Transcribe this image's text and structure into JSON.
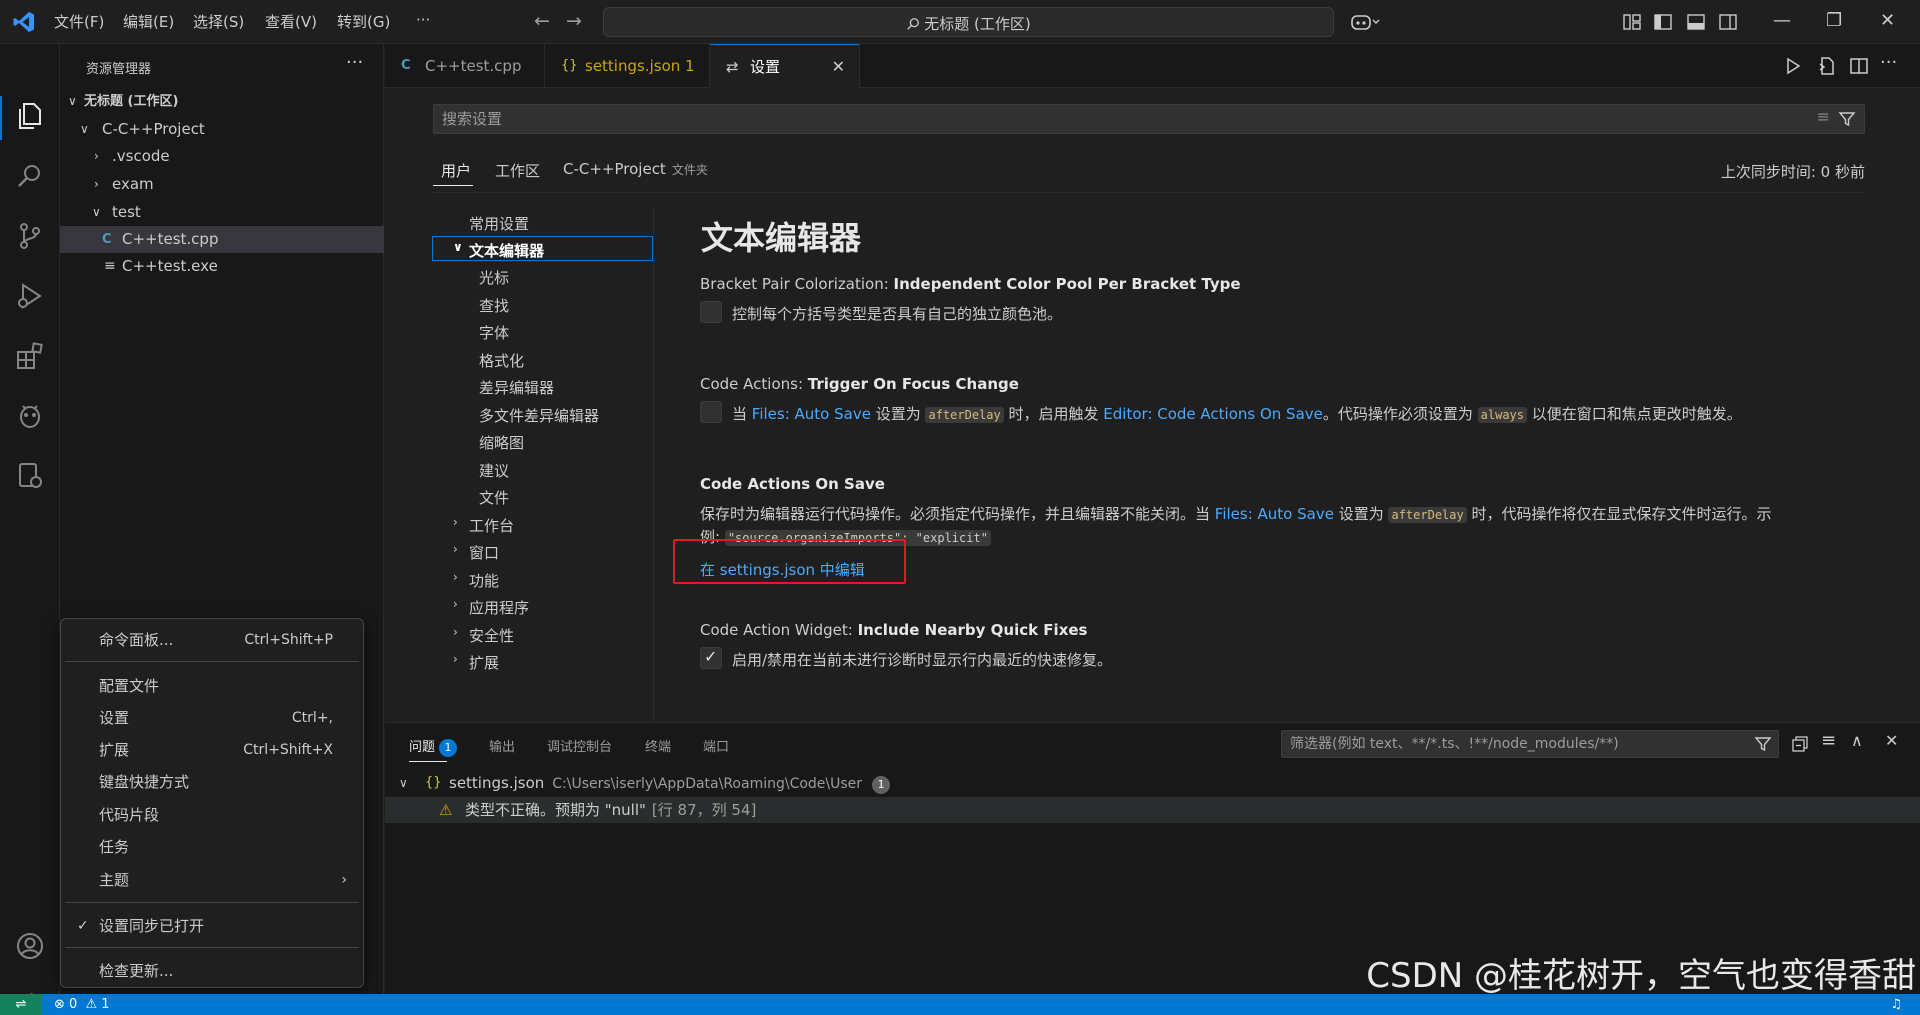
{
  "titlebar": {
    "menus": [
      "文件(F)",
      "编辑(E)",
      "选择(S)",
      "查看(V)",
      "转到(G)"
    ],
    "more": "···",
    "command_center": "无标题 (工作区)",
    "win_min": "—",
    "win_restore": "❐",
    "win_close": "✕"
  },
  "sidebar": {
    "title": "资源管理器",
    "more": "···",
    "workspace": "无标题 (工作区)",
    "folders": {
      "project": "C-C++Project",
      "vscode": ".vscode",
      "exam": "exam",
      "test": "test"
    },
    "files": [
      "C++test.cpp",
      "C++test.exe"
    ]
  },
  "context_menu": {
    "command_palette": {
      "label": "命令面板...",
      "key": "Ctrl+Shift+P"
    },
    "profiles": {
      "label": "配置文件"
    },
    "settings": {
      "label": "设置",
      "key": "Ctrl+,"
    },
    "extensions": {
      "label": "扩展",
      "key": "Ctrl+Shift+X"
    },
    "keyboard_shortcuts": {
      "label": "键盘快捷方式"
    },
    "snippets": {
      "label": "代码片段"
    },
    "tasks": {
      "label": "任务"
    },
    "themes": {
      "label": "主题"
    },
    "settings_sync": {
      "label": "设置同步已打开"
    },
    "check_updates": {
      "label": "检查更新..."
    }
  },
  "tabs": [
    {
      "label": "C++test.cpp",
      "icon": "C"
    },
    {
      "label": "settings.json 1",
      "icon": "{}"
    },
    {
      "label": "设置",
      "icon": "⇄"
    }
  ],
  "settings": {
    "search_placeholder": "搜索设置",
    "scopes": [
      "用户",
      "工作区",
      "C-C++Project"
    ],
    "scope_suffix": "文件夹",
    "sync_time": "上次同步时间: 0 秒前",
    "toc": [
      "常用设置",
      "文本编辑器",
      "光标",
      "查找",
      "字体",
      "格式化",
      "差异编辑器",
      "多文件差异编辑器",
      "缩略图",
      "建议",
      "文件",
      "工作台",
      "窗口",
      "功能",
      "应用程序",
      "安全性",
      "扩展"
    ],
    "group_title": "文本编辑器",
    "items": {
      "bracket": {
        "category": "Bracket Pair Colorization: ",
        "name": "Independent Color Pool Per Bracket Type",
        "desc": "控制每个方括号类型是否具有自己的独立颜色池。"
      },
      "trigger": {
        "category": "Code Actions: ",
        "name": "Trigger On Focus Change",
        "desc_p1": "当 ",
        "link1": "Files: Auto Save",
        "desc_p2": " 设置为 ",
        "code1": "afterDelay",
        "desc_p3": " 时，启用触发 ",
        "link2": "Editor: Code Actions On Save",
        "desc_p4": "。代码操作必须设置为 ",
        "code2": "always",
        "desc_p5": " 以便在窗口和焦点更改时触发。"
      },
      "onsave": {
        "name": "Code Actions On Save",
        "desc_p1": "保存时为编辑器运行代码操作。必须指定代码操作，并且编辑器不能关闭。当 ",
        "link1": "Files: Auto Save",
        "desc_p2": " 设置为 ",
        "code1": "afterDelay",
        "desc_p3": " 时，代码操作将仅在显式保存文件时运行。示",
        "desc_line2": "例: ",
        "code2": "\"source.organizeImports\": \"explicit\"",
        "edit_link": "在 settings.json 中编辑"
      },
      "widget": {
        "category": "Code Action Widget: ",
        "name": "Include Nearby Quick Fixes",
        "desc": "启用/禁用在当前未进行诊断时显示行内最近的快速修复。"
      }
    }
  },
  "panel": {
    "tabs": [
      "问题",
      "输出",
      "调试控制台",
      "终端",
      "端口"
    ],
    "problems_badge": "1",
    "filter_placeholder": "筛选器(例如 text、**/*.ts、!**/node_modules/**)",
    "file": "settings.json",
    "file_path": "C:\\Users\\iserly\\AppData\\Roaming\\Code\\User",
    "file_badge": "1",
    "problem_text": "类型不正确。预期为 \"null\"",
    "problem_loc": "[行 87，列 54]"
  },
  "statusbar": {
    "errors": "0",
    "warnings": "1"
  },
  "watermark": "CSDN @桂花树开，空气也变得香甜",
  "colors": {
    "accent": "#0078d4",
    "link": "#4daafc",
    "highlight_box": "#e01b24"
  }
}
